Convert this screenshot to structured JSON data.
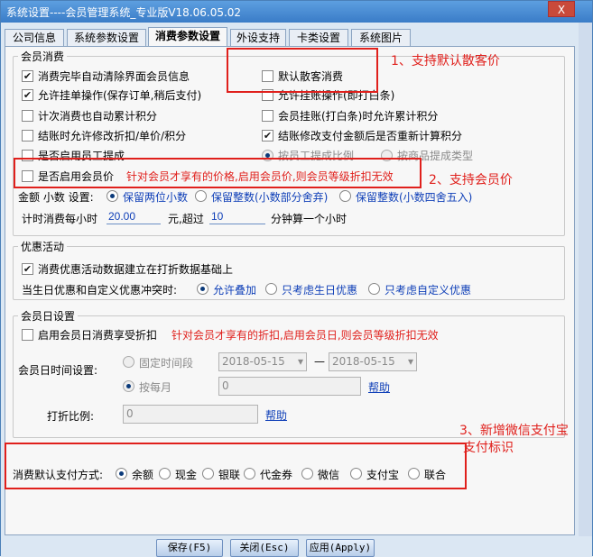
{
  "window": {
    "title": "系统设置----会员管理系统_专业版V18.06.05.02",
    "close_label": "X"
  },
  "tabs": [
    "公司信息",
    "系统参数设置",
    "消费参数设置",
    "外设支持",
    "卡类设置",
    "系统图片"
  ],
  "g1": {
    "title": "会员消费",
    "cb1": "消费完毕自动清除界面会员信息",
    "cb2": "允许挂单操作(保存订单,稍后支付)",
    "cb3": "计次消费也自动累计积分",
    "cb4": "结账时允许修改折扣/单价/积分",
    "cb5": "是否启用员工提成",
    "cb6": "默认散客消费",
    "cb7": "允许挂账操作(即打白条)",
    "cb8": "会员挂账(打白条)时允许累计积分",
    "cb9": "结账修改支付金额后是否重新计算积分",
    "rb_a": "按员工提成比例",
    "rb_b": "按商品提成类型",
    "cb10": "是否启用会员价",
    "note1": "针对会员才享有的价格,启用会员价,则会员等级折扣无效",
    "round_label": "金额 小数 设置:",
    "round1": "保留两位小数",
    "round2": "保留整数(小数部分舍弃)",
    "round3": "保留整数(小数四舍五入)",
    "time_prefix": "计时消费每小时",
    "time_price": "20.00",
    "time_mid": "元,超过",
    "time_minutes": "10",
    "time_suffix": "分钟算一个小时"
  },
  "g2": {
    "title": "优惠活动",
    "cb": "消费优惠活动数据建立在打折数据基础上",
    "conflict_label": "当生日优惠和自定义优惠冲突时:",
    "r1": "允许叠加",
    "r2": "只考虑生日优惠",
    "r3": "只考虑自定义优惠"
  },
  "g3": {
    "title": "会员日设置",
    "cb": "启用会员日消费享受折扣",
    "note": "针对会员才享有的折扣,启用会员日,则会员等级折扣无效",
    "time_label": "会员日时间设置:",
    "r1": "固定时间段",
    "date1": "2018-05-15",
    "dash": "—",
    "date2": "2018-05-15",
    "r2": "按每月",
    "monthly_value": "0",
    "help1": "帮助",
    "discount_label": "打折比例:",
    "discount_value": "0",
    "help2": "帮助"
  },
  "pay": {
    "label": "消费默认支付方式:",
    "options": [
      "余额",
      "现金",
      "银联",
      "代金券",
      "微信",
      "支付宝",
      "联合"
    ]
  },
  "annotations": {
    "a1": "1、支持默认散客价",
    "a2": "2、支持会员价",
    "a3": "3、新增微信支付宝",
    "a3b": "支付标识"
  },
  "buttons": {
    "save": "保存(F5)",
    "close": "关闭(Esc)",
    "apply": "应用(Apply)"
  }
}
